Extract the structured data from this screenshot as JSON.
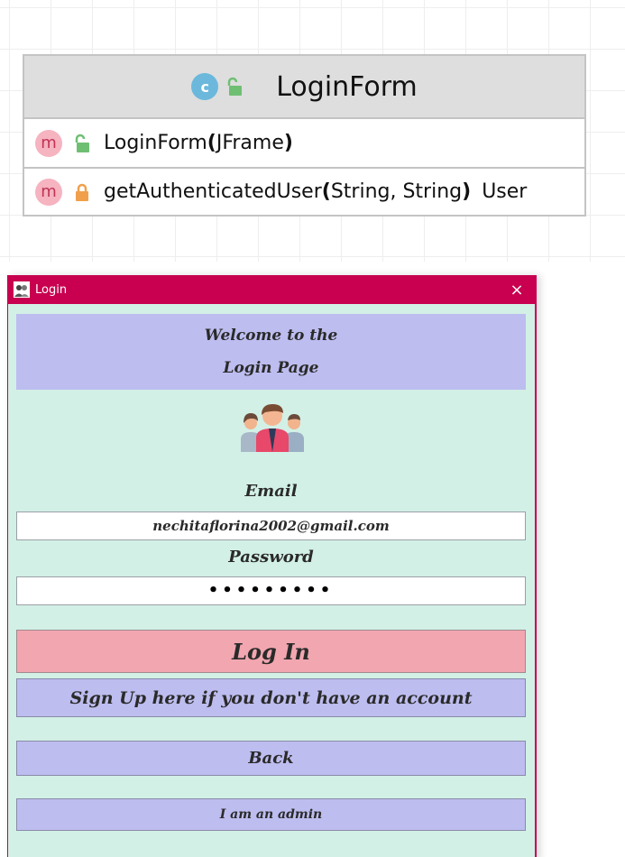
{
  "uml": {
    "class_badge": "c",
    "class_name": "LoginForm",
    "methods": [
      {
        "badge": "m",
        "visibility": "public",
        "name": "LoginForm",
        "open_paren": "(",
        "params": "JFrame",
        "close_paren": ")",
        "return_type": ""
      },
      {
        "badge": "m",
        "visibility": "private",
        "name": "getAuthenticatedUser",
        "open_paren": "(",
        "params": "String, String",
        "close_paren": ")",
        "return_type": "User"
      }
    ],
    "colors": {
      "class_badge": "#6bb8dc",
      "method_badge": "#f6b3c0",
      "public_lock": "#6fbf73",
      "private_lock": "#f0a04b"
    }
  },
  "window": {
    "title": "Login",
    "close_glyph": "×",
    "accent": "#c8004f"
  },
  "login": {
    "welcome_line1": "Welcome to the",
    "welcome_line2": "Login Page",
    "email_label": "Email",
    "email_value": "nechitaflorina2002@gmail.com",
    "password_label": "Password",
    "password_masked": "•••••••••",
    "login_button": "Log In",
    "signup_button": "Sign Up here if you don't have an account",
    "back_button": "Back",
    "admin_button": "I am an admin"
  },
  "icons": {
    "app": "app-logo-icon",
    "avatar": "users-group-icon",
    "close": "close-icon",
    "public": "unlocked-icon",
    "private": "locked-icon"
  }
}
